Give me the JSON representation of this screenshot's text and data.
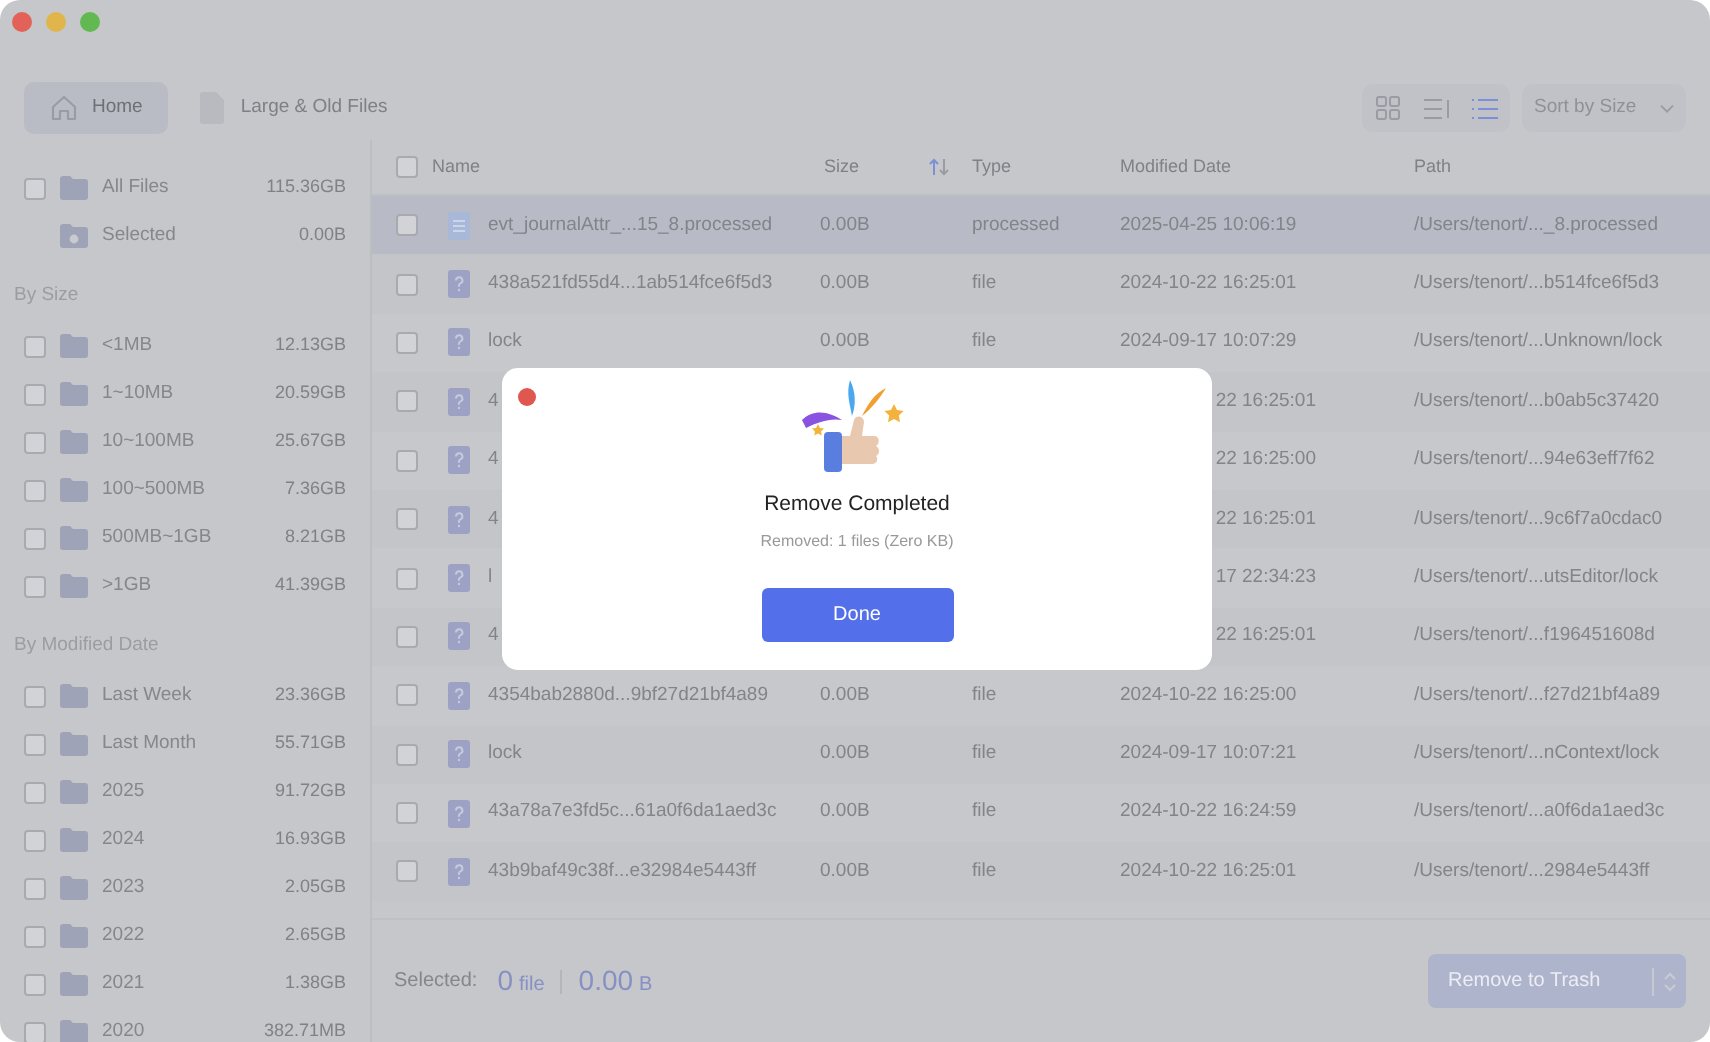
{
  "toolbar": {
    "tabs": [
      {
        "label": "Home",
        "selected": true
      },
      {
        "label": "Large & Old Files",
        "selected": false
      }
    ],
    "views": [
      {
        "selected": false
      },
      {
        "selected": false
      },
      {
        "selected": true
      }
    ],
    "sort": "Sort by Size"
  },
  "sidebar": {
    "groups": [
      {
        "items": [
          {
            "label": "All Files",
            "value": "115.36GB",
            "kind": "check",
            "checked": false
          },
          {
            "label": "Selected",
            "value": "0.00B",
            "kind": "plain"
          }
        ]
      },
      {
        "title": "By Size",
        "items": [
          {
            "label": "<1MB",
            "value": "12.13GB",
            "kind": "check",
            "checked": false
          },
          {
            "label": "1~10MB",
            "value": "20.59GB",
            "kind": "check",
            "checked": false
          },
          {
            "label": "10~100MB",
            "value": "25.67GB",
            "kind": "check",
            "checked": false
          },
          {
            "label": "100~500MB",
            "value": "7.36GB",
            "kind": "check",
            "checked": false
          },
          {
            "label": "500MB~1GB",
            "value": "8.21GB",
            "kind": "check",
            "checked": false
          },
          {
            "label": ">1GB",
            "value": "41.39GB",
            "kind": "check",
            "checked": false
          }
        ]
      },
      {
        "title": "By Modified Date",
        "items": [
          {
            "label": "Last Week",
            "value": "23.36GB",
            "kind": "check",
            "checked": false
          },
          {
            "label": "Last Month",
            "value": "55.71GB",
            "kind": "check",
            "checked": false
          },
          {
            "label": "2025",
            "value": "91.72GB",
            "kind": "check",
            "checked": false
          },
          {
            "label": "2024",
            "value": "16.93GB",
            "kind": "check",
            "checked": false
          },
          {
            "label": "2023",
            "value": "2.05GB",
            "kind": "check",
            "checked": false
          },
          {
            "label": "2022",
            "value": "2.65GB",
            "kind": "check",
            "checked": false
          },
          {
            "label": "2021",
            "value": "1.38GB",
            "kind": "check",
            "checked": false
          },
          {
            "label": "2020",
            "value": "382.71MB",
            "kind": "check",
            "checked": false
          }
        ]
      }
    ]
  },
  "table": {
    "all_checked": false,
    "columns": [
      "Name",
      "Size",
      "Type",
      "Modified Date",
      "Path"
    ],
    "rows": [
      {
        "kind": "doc",
        "name": "evt_journalAttr_...15_8.processed",
        "size": "0.00B",
        "type": "processed",
        "modified": "2025-04-25 10:06:19",
        "path": "/Users/tenort/..._8.processed",
        "selected": true,
        "checked": false
      },
      {
        "kind": "unknown",
        "name": "438a521fd55d4...1ab514fce6f5d3",
        "size": "0.00B",
        "type": "file",
        "modified": "2024-10-22 16:25:01",
        "path": "/Users/tenort/...b514fce6f5d3",
        "selected": false,
        "checked": false
      },
      {
        "kind": "unknown",
        "name": "lock",
        "size": "0.00B",
        "type": "file",
        "modified": "2024-09-17 10:07:29",
        "path": "/Users/tenort/...Unknown/lock",
        "selected": false,
        "checked": false
      },
      {
        "kind": "unknown",
        "name": "4",
        "modified": "22 16:25:01",
        "path": "/Users/tenort/...b0ab5c37420",
        "selected": false,
        "checked": false
      },
      {
        "kind": "unknown",
        "name": "4",
        "modified": "22 16:25:00",
        "path": "/Users/tenort/...94e63eff7f62",
        "selected": false,
        "checked": false
      },
      {
        "kind": "unknown",
        "name": "4",
        "modified": "22 16:25:01",
        "path": "/Users/tenort/...9c6f7a0cdac0",
        "selected": false,
        "checked": false
      },
      {
        "kind": "unknown",
        "name": "l",
        "modified": "17 22:34:23",
        "path": "/Users/tenort/...utsEditor/lock",
        "selected": false,
        "checked": false
      },
      {
        "kind": "unknown",
        "name": "4",
        "modified": "22 16:25:01",
        "path": "/Users/tenort/...f196451608d",
        "selected": false,
        "checked": false
      },
      {
        "kind": "unknown",
        "name": "4354bab2880d...9bf27d21bf4a89",
        "size": "0.00B",
        "type": "file",
        "modified": "2024-10-22 16:25:00",
        "path": "/Users/tenort/...f27d21bf4a89",
        "selected": false,
        "checked": false
      },
      {
        "kind": "unknown",
        "name": "lock",
        "size": "0.00B",
        "type": "file",
        "modified": "2024-09-17 10:07:21",
        "path": "/Users/tenort/...nContext/lock",
        "selected": false,
        "checked": false
      },
      {
        "kind": "unknown",
        "name": "43a78a7e3fd5c...61a0f6da1aed3c",
        "size": "0.00B",
        "type": "file",
        "modified": "2024-10-22 16:24:59",
        "path": "/Users/tenort/...a0f6da1aed3c",
        "selected": false,
        "checked": false
      },
      {
        "kind": "unknown",
        "name": "43b9baf49c38f...e32984e5443ff",
        "size": "0.00B",
        "type": "file",
        "modified": "2024-10-22 16:25:01",
        "path": "/Users/tenort/...2984e5443ff",
        "selected": false,
        "checked": false
      }
    ]
  },
  "footer": {
    "label": "Selected:",
    "count": "0",
    "count_unit": "file",
    "size": "0.00",
    "size_unit": "B",
    "button": "Remove to Trash",
    "button_disabled": true
  },
  "dialog": {
    "title": "Remove Completed",
    "message": "Removed: 1 files (Zero KB)",
    "button": "Done"
  }
}
